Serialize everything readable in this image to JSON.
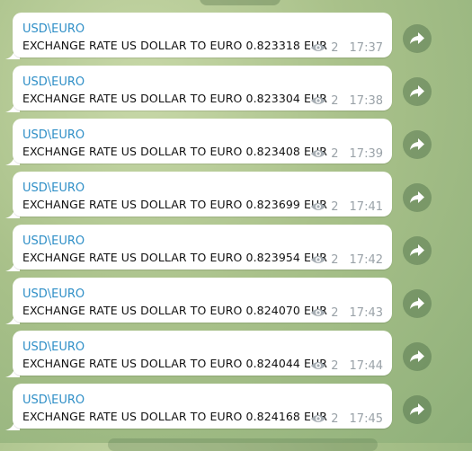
{
  "messages": [
    {
      "sender": "USD\\EURO",
      "text": "EXCHANGE RATE US DOLLAR TO EURO 0.823318 EUR",
      "views": "2",
      "time": "17:37"
    },
    {
      "sender": "USD\\EURO",
      "text": "EXCHANGE RATE US DOLLAR TO EURO 0.823304 EUR",
      "views": "2",
      "time": "17:38"
    },
    {
      "sender": "USD\\EURO",
      "text": "EXCHANGE RATE US DOLLAR TO EURO 0.823408 EUR",
      "views": "2",
      "time": "17:39"
    },
    {
      "sender": "USD\\EURO",
      "text": "EXCHANGE RATE US DOLLAR TO EURO 0.823699 EUR",
      "views": "2",
      "time": "17:41"
    },
    {
      "sender": "USD\\EURO",
      "text": "EXCHANGE RATE US DOLLAR TO EURO 0.823954 EUR",
      "views": "2",
      "time": "17:42"
    },
    {
      "sender": "USD\\EURO",
      "text": "EXCHANGE RATE US DOLLAR TO EURO 0.824070 EUR",
      "views": "2",
      "time": "17:43"
    },
    {
      "sender": "USD\\EURO",
      "text": "EXCHANGE RATE US DOLLAR TO EURO 0.824044 EUR",
      "views": "2",
      "time": "17:44"
    },
    {
      "sender": "USD\\EURO",
      "text": "EXCHANGE RATE US DOLLAR TO EURO 0.824168 EUR",
      "views": "2",
      "time": "17:45"
    }
  ],
  "icons": {
    "views": "eye-icon",
    "share": "share-arrow-icon"
  },
  "colors": {
    "sender": "#2f8fc7",
    "meta": "#9aa2a8",
    "bubble": "#ffffff"
  }
}
